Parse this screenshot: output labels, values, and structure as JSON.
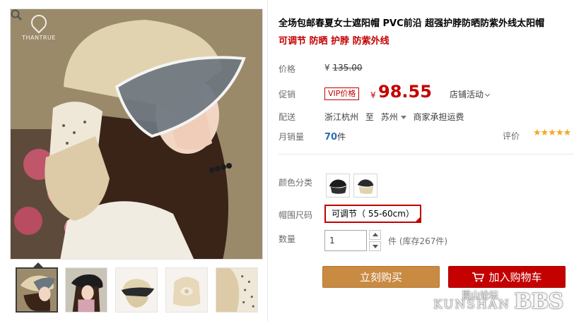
{
  "logo": {
    "text": "THANTRUE"
  },
  "title": "全场包邮春夏女士遮阳帽 PVC前沿 超强护脖防晒防紫外线太阳帽",
  "subtitle": "可调节 防晒 护脖 防紫外线",
  "price": {
    "label": "价格",
    "currency": "¥",
    "original": "135.00"
  },
  "promo": {
    "label": "促销",
    "tag": "VIP价格",
    "currency": "¥",
    "price": "98.55",
    "activity": "店铺活动"
  },
  "shipping": {
    "label": "配送",
    "from": "浙江杭州",
    "to_word": "至",
    "to": "苏州",
    "fee": "商家承担运费"
  },
  "sales": {
    "label": "月销量",
    "count": "70",
    "unit": "件",
    "rating_label": "评价",
    "stars": "★★★★★"
  },
  "color": {
    "label": "颜色分类"
  },
  "size": {
    "label": "帽围尺码",
    "option": "可调节（ 55-60cm）"
  },
  "quantity": {
    "label": "数量",
    "value": "1",
    "stock": "件 (库存267件)"
  },
  "buttons": {
    "buy": "立刻购买",
    "cart": "加入购物车"
  },
  "watermark": {
    "cn": "昆山论坛",
    "en": "KUNSHAN",
    "bbs": "BBS"
  },
  "colors": {
    "accent_red": "#c40000",
    "buy_orange": "#c98a42",
    "link_blue": "#2d6db3",
    "star": "#f5a623"
  }
}
